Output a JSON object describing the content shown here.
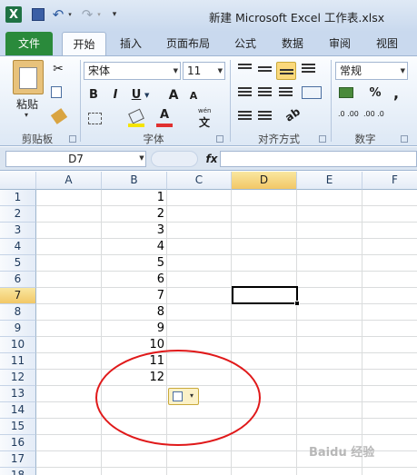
{
  "window": {
    "title": "新建 Microsoft Excel 工作表.xlsx",
    "app_icon": "X"
  },
  "quick_access": {
    "save_icon": "save-icon",
    "undo_glyph": "↶",
    "redo_glyph": "↷",
    "dropdown_glyph": "▾",
    "customize_glyph": "▾"
  },
  "tabs": [
    {
      "label": "文件"
    },
    {
      "label": "开始"
    },
    {
      "label": "插入"
    },
    {
      "label": "页面布局"
    },
    {
      "label": "公式"
    },
    {
      "label": "数据"
    },
    {
      "label": "审阅"
    },
    {
      "label": "视图"
    }
  ],
  "ribbon": {
    "clipboard": {
      "label": "剪贴板",
      "paste_label": "粘贴",
      "paste_dropdown": "▾"
    },
    "font": {
      "label": "字体",
      "font_name": "宋体",
      "font_size": "11",
      "bold": "B",
      "italic": "I",
      "underline": "U",
      "grow": "A",
      "shrink": "A",
      "font_color_letter": "A",
      "wen": "wén",
      "wen_char": "文",
      "font_color": "#e03030",
      "fill_color": "#f5e400"
    },
    "alignment": {
      "label": "对齐方式"
    },
    "number": {
      "label": "数字",
      "format": "常规",
      "percent": "%",
      "comma": ",",
      "inc_decimal": ".0 .00",
      "dec_decimal": ".00 .0"
    }
  },
  "formula_bar": {
    "name_box": "D7",
    "fx": "fx",
    "formula": ""
  },
  "sheet": {
    "columns": [
      "A",
      "B",
      "C",
      "D",
      "E",
      "F"
    ],
    "selected_column": "D",
    "rows": [
      "1",
      "2",
      "3",
      "4",
      "5",
      "6",
      "7",
      "8",
      "9",
      "10",
      "11",
      "12",
      "13",
      "14",
      "15",
      "16",
      "17",
      "18"
    ],
    "selected_row": "7",
    "column_b_values": [
      "1",
      "2",
      "3",
      "4",
      "5",
      "6",
      "7",
      "8",
      "9",
      "10",
      "11",
      "12"
    ],
    "active_cell": "D7",
    "annotation_color": "#e0191a",
    "paste_options_glyph": "▾"
  },
  "watermark": "Baidu 经验"
}
